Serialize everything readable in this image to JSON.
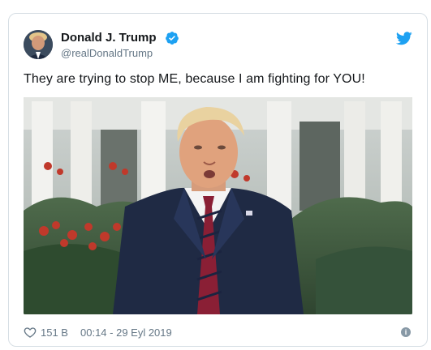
{
  "author": {
    "name": "Donald J. Trump",
    "handle": "@realDonaldTrump",
    "verified": true
  },
  "tweet": {
    "text": "They are trying to stop ME, because I am fighting for YOU!"
  },
  "footer": {
    "like_count": "151 B",
    "timestamp": "00:14 - 29 Eyl 2019",
    "info_glyph": "i"
  },
  "icons": [
    "avatar",
    "verified-badge-icon",
    "twitter-bird-icon",
    "heart-icon",
    "info-icon"
  ],
  "colors": {
    "accent": "#1da1f2",
    "text": "#14171a",
    "muted": "#657786",
    "border": "#d6dee4"
  }
}
